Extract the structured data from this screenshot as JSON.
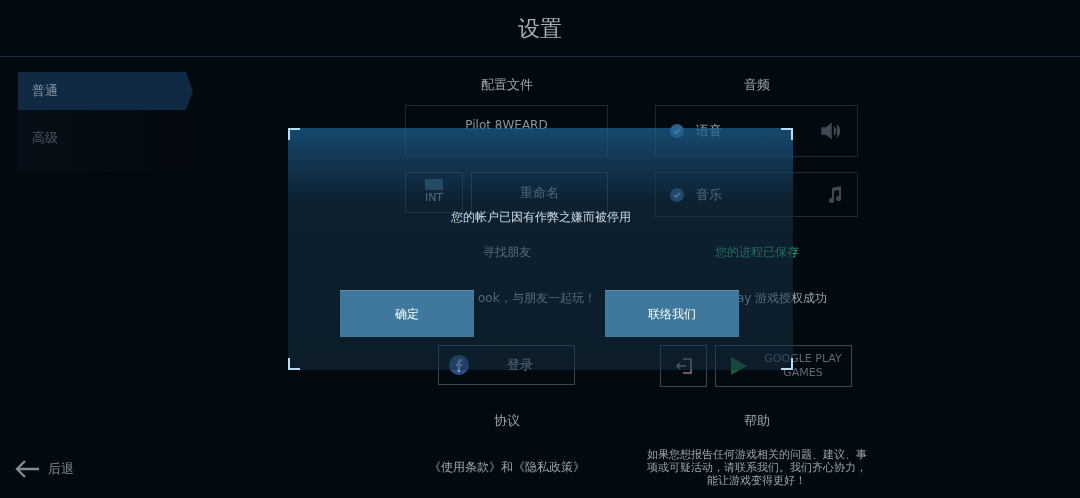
{
  "title": "设置",
  "sidebar": {
    "items": [
      {
        "label": "普通",
        "selected": true
      },
      {
        "label": "高级",
        "selected": false
      }
    ]
  },
  "back_button": "后退",
  "profile": {
    "heading": "配置文件",
    "name": "Pilot 8WEARD",
    "region": "INT",
    "rename_button": "重命名",
    "find_friends": "寻找朋友",
    "facebook_hint": "ook，与朋友一起玩！",
    "login_button": "登录"
  },
  "audio": {
    "heading": "音频",
    "options": [
      {
        "label": "语音",
        "kind": "voice",
        "checked": true
      },
      {
        "label": "音乐",
        "kind": "music",
        "checked": true
      }
    ],
    "progress_saved": "您的进程已保存",
    "play_status": "ay 游戏授权成功",
    "google_play_button": "GOOGLE PLAY GAMES"
  },
  "agreement": {
    "heading": "协议",
    "links": "《使用条款》和《隐私政策》"
  },
  "help": {
    "heading": "帮助",
    "text": "如果您想报告任何游戏相关的问题、建议、事项或可疑活动，请联系我们。我们齐心协力，能让游戏变得更好！"
  },
  "dialog": {
    "message": "您的帐户已因有作弊之嫌而被停用",
    "buttons": [
      "确定",
      "联络我们"
    ]
  }
}
